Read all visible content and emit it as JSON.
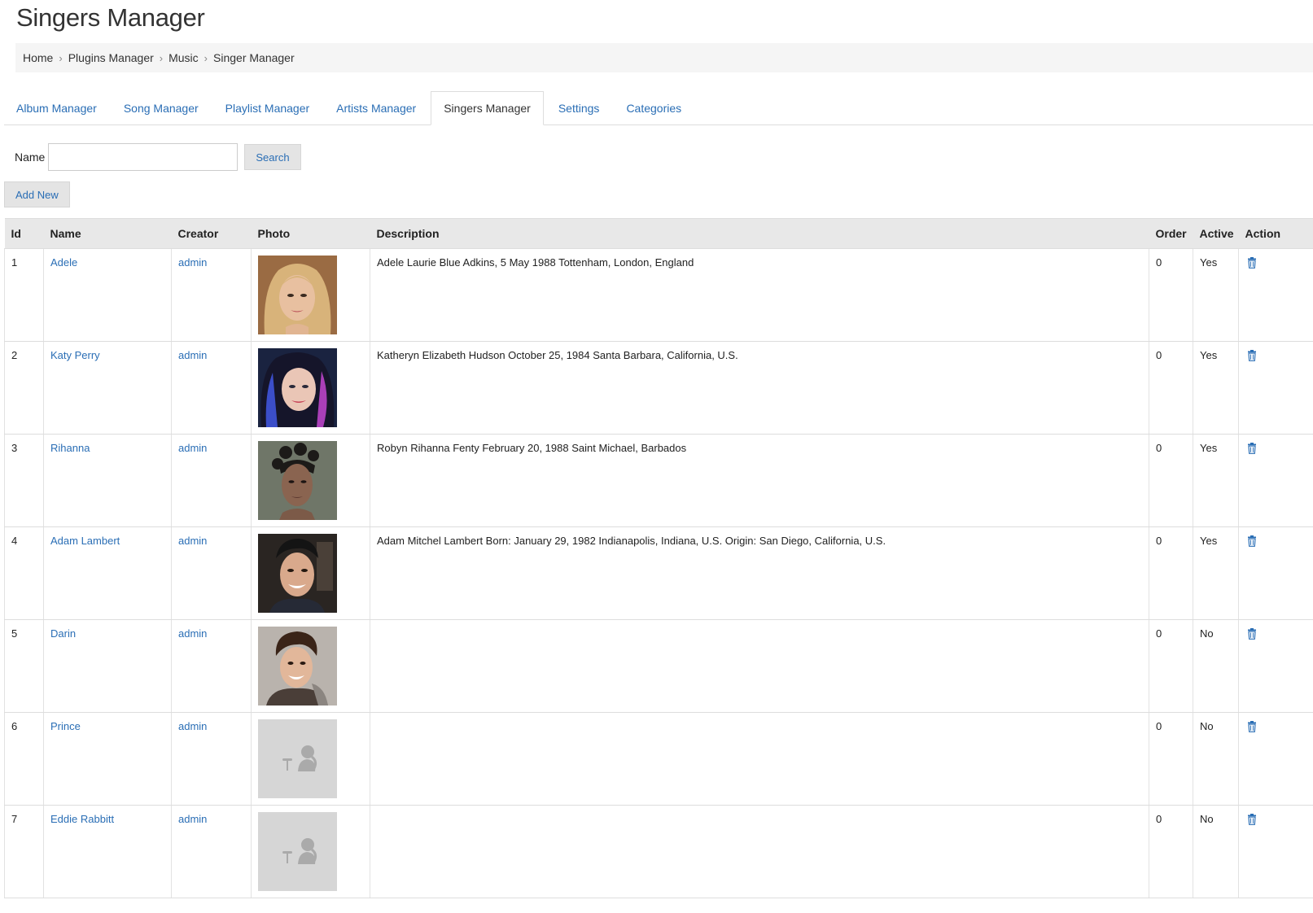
{
  "page": {
    "title": "Singers Manager"
  },
  "breadcrumb": [
    "Home",
    "Plugins Manager",
    "Music",
    "Singer Manager"
  ],
  "tabs": [
    {
      "label": "Album Manager",
      "active": false
    },
    {
      "label": "Song Manager",
      "active": false
    },
    {
      "label": "Playlist Manager",
      "active": false
    },
    {
      "label": "Artists Manager",
      "active": false
    },
    {
      "label": "Singers Manager",
      "active": true
    },
    {
      "label": "Settings",
      "active": false
    },
    {
      "label": "Categories",
      "active": false
    }
  ],
  "search": {
    "label": "Name",
    "value": "",
    "placeholder": "",
    "button_label": "Search"
  },
  "add_button_label": "Add New",
  "table": {
    "columns": [
      "Id",
      "Name",
      "Creator",
      "Photo",
      "Description",
      "Order",
      "Active",
      "Action"
    ],
    "rows": [
      {
        "id": "1",
        "name": "Adele",
        "creator": "admin",
        "photo": "adele-photo",
        "description": "Adele Laurie Blue Adkins, 5 May 1988 Tottenham, London, England",
        "order": "0",
        "active": "Yes"
      },
      {
        "id": "2",
        "name": "Katy Perry",
        "creator": "admin",
        "photo": "katy-perry-photo",
        "description": "Katheryn Elizabeth Hudson October 25, 1984 Santa Barbara, California, U.S.",
        "order": "0",
        "active": "Yes"
      },
      {
        "id": "3",
        "name": "Rihanna",
        "creator": "admin",
        "photo": "rihanna-photo",
        "description": "Robyn Rihanna Fenty February 20, 1988 Saint Michael, Barbados",
        "order": "0",
        "active": "Yes"
      },
      {
        "id": "4",
        "name": "Adam Lambert",
        "creator": "admin",
        "photo": "adam-lambert-photo",
        "description": "Adam Mitchel Lambert Born: January 29, 1982 Indianapolis, Indiana, U.S. Origin: San Diego, California, U.S.",
        "order": "0",
        "active": "Yes"
      },
      {
        "id": "5",
        "name": "Darin",
        "creator": "admin",
        "photo": "darin-photo",
        "description": "",
        "order": "0",
        "active": "No"
      },
      {
        "id": "6",
        "name": "Prince",
        "creator": "admin",
        "photo": "placeholder-singer-icon",
        "description": "",
        "order": "0",
        "active": "No"
      },
      {
        "id": "7",
        "name": "Eddie Rabbitt",
        "creator": "admin",
        "photo": "placeholder-singer-icon",
        "description": "",
        "order": "0",
        "active": "No"
      }
    ]
  },
  "icons": {
    "action": "trash-icon",
    "placeholder": "microphone-singer-icon"
  },
  "colors": {
    "link": "#2a6eb5",
    "header_bg": "#e8e8e8",
    "breadcrumb_bg": "#f5f5f5"
  }
}
